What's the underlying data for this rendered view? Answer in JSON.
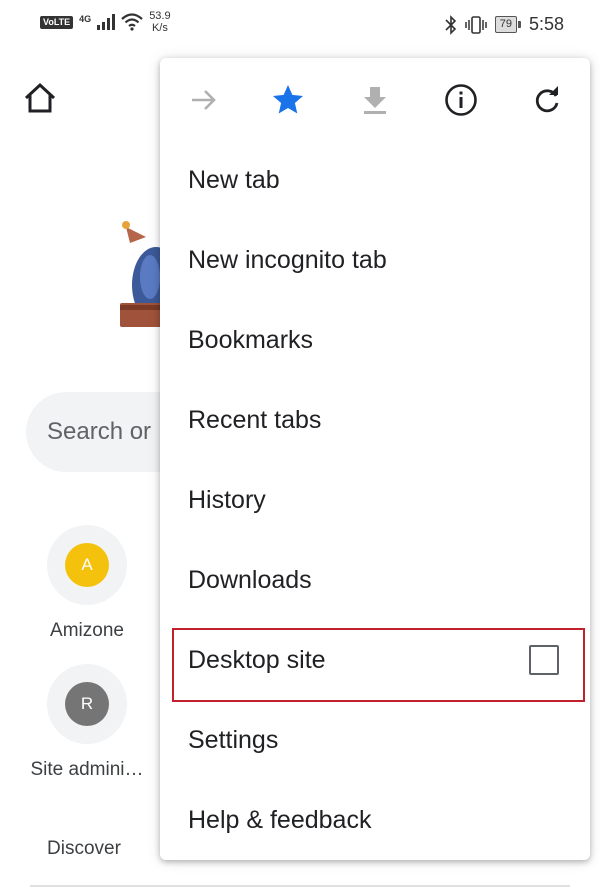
{
  "status_bar": {
    "volte": "VoLTE",
    "network": "4G",
    "speed_value": "53.9",
    "speed_unit": "K/s",
    "battery": "79",
    "time": "5:58"
  },
  "background": {
    "search_placeholder": "Search or",
    "tiles": [
      {
        "letter": "A",
        "label": "Amizone",
        "color": "#f4c20d"
      },
      {
        "letter": "R",
        "label": "Site admini…",
        "color": "#757575"
      }
    ],
    "discover": "Discover"
  },
  "menu": {
    "toolbar_icons": [
      "forward-arrow-icon",
      "bookmark-star-icon",
      "download-icon",
      "info-icon",
      "refresh-icon"
    ],
    "items": [
      {
        "label": "New tab"
      },
      {
        "label": "New incognito tab"
      },
      {
        "label": "Bookmarks"
      },
      {
        "label": "Recent tabs"
      },
      {
        "label": "History"
      },
      {
        "label": "Downloads"
      },
      {
        "label": "Desktop site",
        "checked": false
      },
      {
        "label": "Settings"
      },
      {
        "label": "Help & feedback"
      }
    ]
  },
  "colors": {
    "accent_blue": "#1a73e8",
    "highlight_red": "#c0212c"
  }
}
